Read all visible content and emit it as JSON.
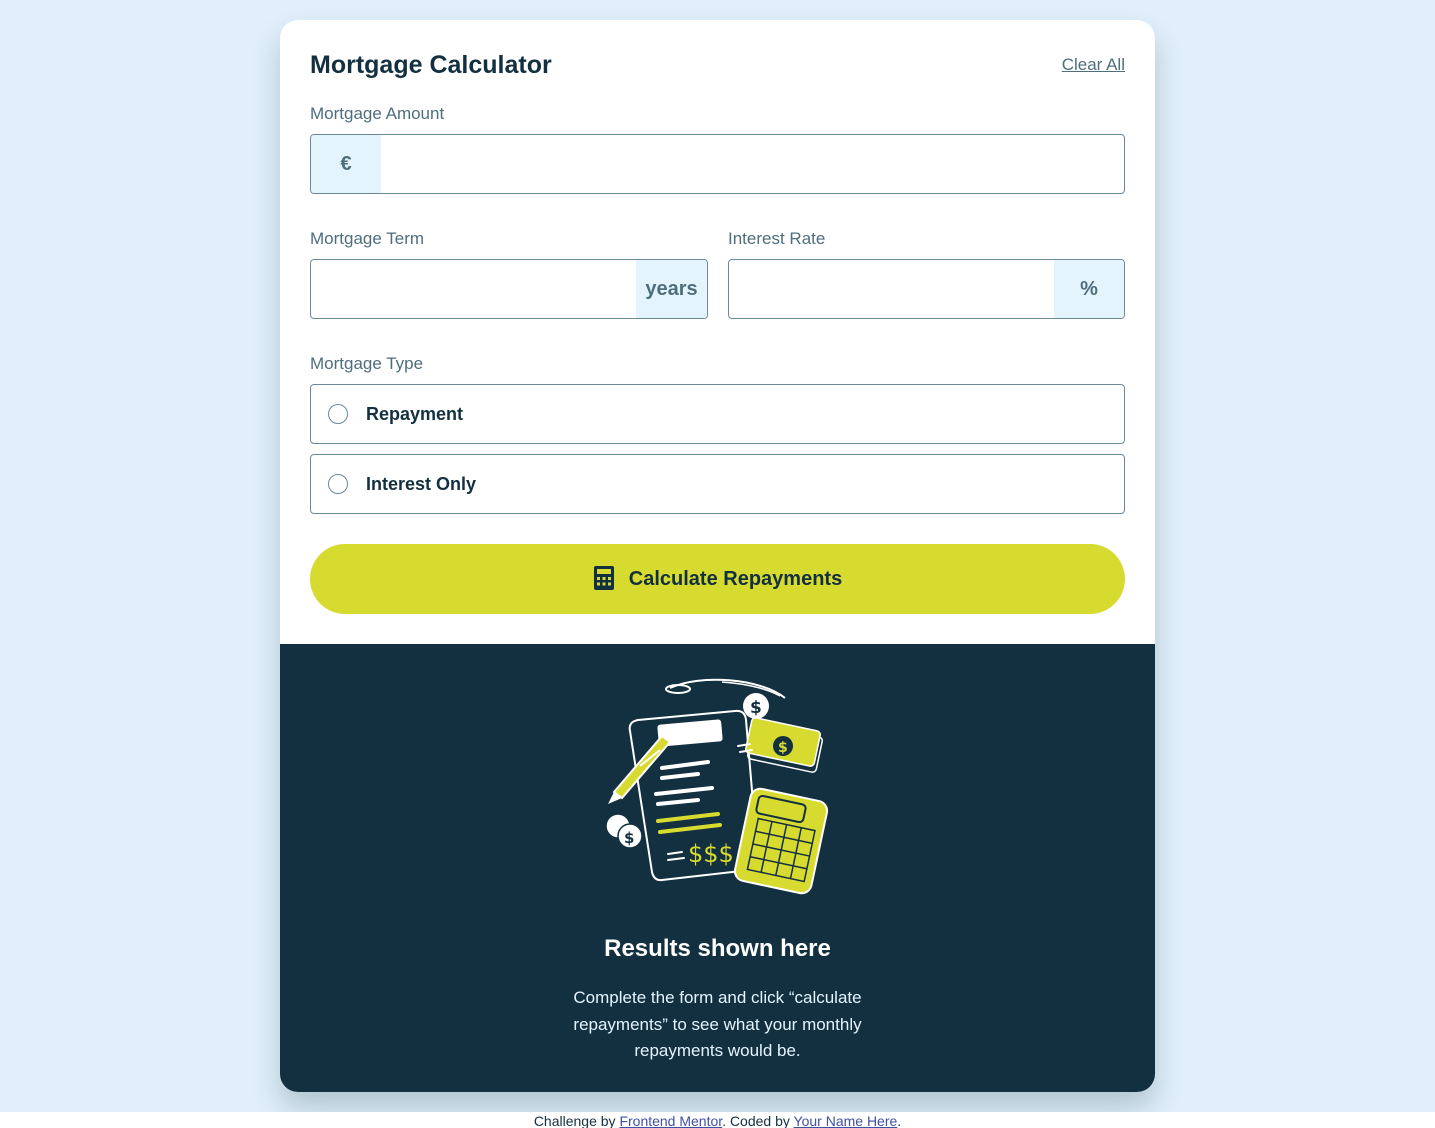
{
  "header": {
    "title": "Mortgage Calculator",
    "clear_all": "Clear All"
  },
  "fields": {
    "amount": {
      "label": "Mortgage Amount",
      "prefix": "€",
      "value": ""
    },
    "term": {
      "label": "Mortgage Term",
      "suffix": "years",
      "value": ""
    },
    "rate": {
      "label": "Interest Rate",
      "suffix": "%",
      "value": ""
    }
  },
  "mortgage_type": {
    "label": "Mortgage Type",
    "options": [
      {
        "label": "Repayment",
        "selected": false
      },
      {
        "label": "Interest Only",
        "selected": false
      }
    ]
  },
  "calculate": {
    "label": "Calculate Repayments",
    "icon": "calculator-icon"
  },
  "results": {
    "title": "Results shown here",
    "text": "Complete the form and click “calculate repayments” to see what your monthly repayments would be.",
    "illustration": "empty-results-illustration"
  },
  "footer": {
    "prefix": "Challenge by ",
    "link1": "Frontend Mentor",
    "middle": ". Coded by ",
    "link2": "Your Name Here",
    "suffix": "."
  },
  "colors": {
    "background": "#e0effb",
    "primary": "#d8db2f",
    "dark": "#133041",
    "slate": "#4e6e7e",
    "addon_bg": "#e4f4fd"
  }
}
